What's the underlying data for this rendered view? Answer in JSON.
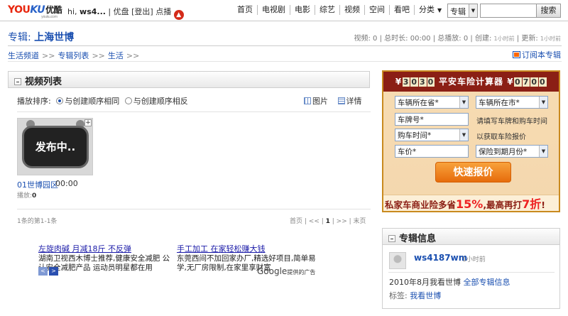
{
  "topbar": {
    "logo_you": "YOU",
    "logo_ku": "KU",
    "logo_cn": "优酷",
    "logo_net": "youku.com",
    "greeting": "hi,",
    "username": "ws4...",
    "links": [
      "优盘",
      "[登出]",
      "点播"
    ],
    "nav": [
      "首页",
      "电视剧",
      "电影",
      "综艺",
      "视频",
      "空间",
      "看吧",
      "分类"
    ],
    "search_scope": "专辑",
    "search_button": "搜索",
    "search_value": ""
  },
  "header": {
    "title_prefix": "专辑:",
    "title": "上海世博",
    "stats": {
      "videos_label": "视频:",
      "videos": "0",
      "duration_label": "总时长:",
      "duration": "00:00",
      "plays_label": "总播放:",
      "plays": "0",
      "created_label": "创建:",
      "created": "1小时前",
      "updated_label": "更新:",
      "updated": "1小时前"
    }
  },
  "breadcrumb": [
    "生活频道",
    "专辑列表",
    "生活"
  ],
  "subscribe_label": "订阅本专辑",
  "video_panel": {
    "title": "视频列表",
    "sort_label": "播放排序:",
    "sort_options": [
      "与创建顺序相同",
      "与创建顺序相反"
    ],
    "view_options": [
      "图片",
      "详情"
    ],
    "videos": [
      {
        "thumb_text": "发布中..",
        "name": "01世博园区",
        "duration": "00:00",
        "plays_label": "播放:",
        "plays": "0"
      }
    ],
    "count_info": "1条的第1-1条",
    "pager": [
      "首页",
      "<<",
      "1",
      ">>",
      "末页"
    ]
  },
  "ads": [
    {
      "title": "左旋肉碱 月减18斤 不反弹",
      "desc": "湖南卫视西木博士推荐,健康安全减肥 公认安全减肥产品 运动员明星都在用"
    },
    {
      "title": "手工加工 在家轻松赚大钱",
      "desc": "东莞西间不加回家办厂,精选好项目,简单易学,无厂房限制,在家里享财富"
    }
  ],
  "ad_nav": [
    "<",
    ">"
  ],
  "google_label": "Google",
  "google_suffix": "提供的广告",
  "banner": {
    "left_number": [
      "3",
      "0",
      "3",
      "0"
    ],
    "title": "平安车险计算器",
    "right_number": [
      "0",
      "7",
      "0",
      "0"
    ],
    "fields": {
      "province": "车辆所在省*",
      "city": "车辆所在市*",
      "plate": "车牌号*",
      "purchase_time": "购车时间*",
      "price": "车价*",
      "expiry": "保险到期月份*"
    },
    "hint1": "请填写车牌和购车时间",
    "hint2": "以获取车险报价",
    "quote_button": "快速报价",
    "bottom_text_a": "私家车商业险多省",
    "bottom_pct": "15%",
    "bottom_text_b": ",最高再打",
    "bottom_discount": "7折",
    "bottom_end": "!"
  },
  "album_info": {
    "title": "专辑信息",
    "user": "ws4187wm",
    "time": "1小时前",
    "created_text": "2010年8月我看世博",
    "created_link": "全部专辑信息",
    "tags_label": "标签:",
    "tag": "我看世博"
  }
}
